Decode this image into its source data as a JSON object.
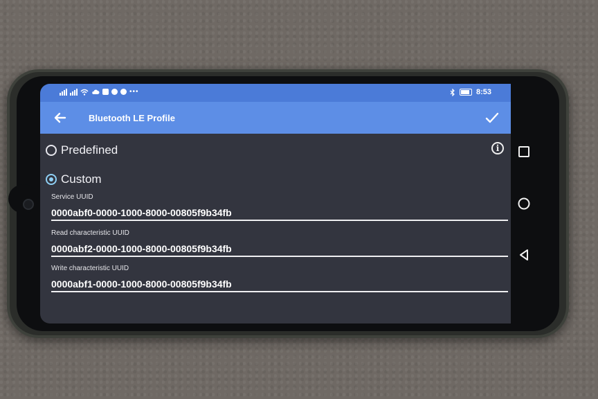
{
  "status_bar": {
    "left_icons": [
      "signal-icon",
      "wifi-icon",
      "cloud-icon",
      "yahoo-icon",
      "dot-icon",
      "dot-icon",
      "more-icon"
    ],
    "right_icons": [
      "bluetooth-icon",
      "battery-icon"
    ],
    "time": "8:53"
  },
  "toolbar": {
    "back_icon": "arrow-left-icon",
    "title": "Bluetooth LE Profile",
    "confirm_icon": "check-icon"
  },
  "profile_options": {
    "predefined_label": "Predefined",
    "predefined_selected": false,
    "custom_label": "Custom",
    "custom_selected": true,
    "info_glyph": "i"
  },
  "fields": {
    "service_uuid_label": "Service UUID",
    "service_uuid_value": "0000abf0-0000-1000-8000-00805f9b34fb",
    "read_uuid_label": "Read characteristic UUID",
    "read_uuid_value": "0000abf2-0000-1000-8000-00805f9b34fb",
    "write_uuid_label": "Write characteristic UUID",
    "write_uuid_value": "0000abf1-0000-1000-8000-00805f9b34fb"
  },
  "nav_bar": {
    "buttons": [
      "recents-square-icon",
      "home-circle-icon",
      "back-triangle-icon"
    ]
  },
  "colors": {
    "status_bar": "#4b7bd8",
    "toolbar": "#5d8ee6",
    "background": "#33353f",
    "radio_accent": "#8fd0f5"
  }
}
